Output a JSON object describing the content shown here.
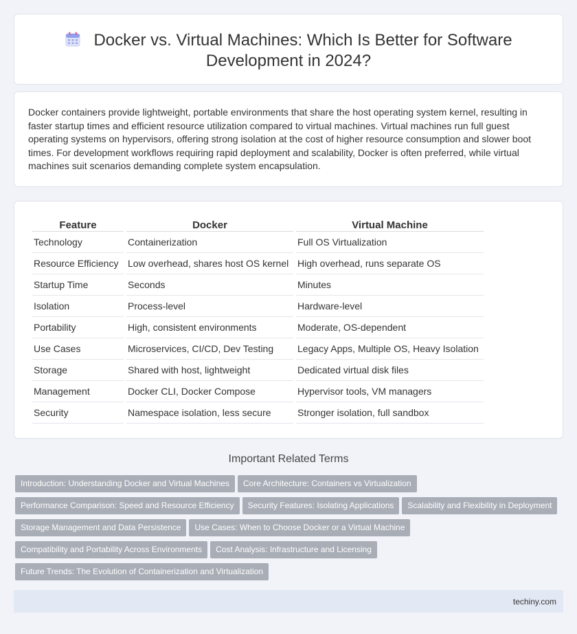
{
  "header": {
    "title_line1": "Docker vs. Virtual Machines: Which Is Better for Software",
    "title_line2": "Development in 2024?",
    "icon": "calendar-icon"
  },
  "intro": {
    "text": "Docker containers provide lightweight, portable environments that share the host operating system kernel, resulting in faster startup times and efficient resource utilization compared to virtual machines. Virtual machines run full guest operating systems on hypervisors, offering strong isolation at the cost of higher resource consumption and slower boot times. For development workflows requiring rapid deployment and scalability, Docker is often preferred, while virtual machines suit scenarios demanding complete system encapsulation."
  },
  "table": {
    "headers": [
      "Feature",
      "Docker",
      "Virtual Machine"
    ],
    "rows": [
      [
        "Technology",
        "Containerization",
        "Full OS Virtualization"
      ],
      [
        "Resource Efficiency",
        "Low overhead, shares host OS kernel",
        "High overhead, runs separate OS"
      ],
      [
        "Startup Time",
        "Seconds",
        "Minutes"
      ],
      [
        "Isolation",
        "Process-level",
        "Hardware-level"
      ],
      [
        "Portability",
        "High, consistent environments",
        "Moderate, OS-dependent"
      ],
      [
        "Use Cases",
        "Microservices, CI/CD, Dev Testing",
        "Legacy Apps, Multiple OS, Heavy Isolation"
      ],
      [
        "Storage",
        "Shared with host, lightweight",
        "Dedicated virtual disk files"
      ],
      [
        "Management",
        "Docker CLI, Docker Compose",
        "Hypervisor tools, VM managers"
      ],
      [
        "Security",
        "Namespace isolation, less secure",
        "Stronger isolation, full sandbox"
      ]
    ]
  },
  "terms": {
    "heading": "Important Related Terms",
    "rows": [
      [
        "Introduction: Understanding Docker and Virtual Machines",
        "Core Architecture: Containers vs Virtualization"
      ],
      [
        "Performance Comparison: Speed and Resource Efficiency",
        "Security Features: Isolating Applications",
        "Scalability and Flexibility in Deployment"
      ],
      [
        "Storage Management and Data Persistence",
        "Use Cases: When to Choose Docker or a Virtual Machine"
      ],
      [
        "Compatibility and Portability Across Environments",
        "Cost Analysis: Infrastructure and Licensing"
      ],
      [
        "Future Trends: The Evolution of Containerization and Virtualization"
      ]
    ]
  },
  "footer": {
    "site": "techiny.com"
  },
  "colors": {
    "background": "#f1f3f8",
    "tag": "#a8adb6",
    "footer": "#e3e9f4"
  }
}
